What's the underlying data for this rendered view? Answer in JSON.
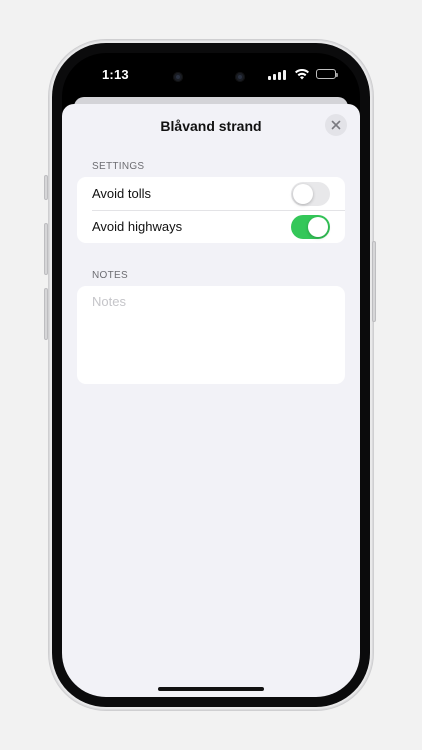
{
  "status_bar": {
    "time": "1:13",
    "icons": [
      "signal-icon",
      "wifi-icon",
      "battery-icon"
    ]
  },
  "sheet": {
    "title": "Blåvand strand",
    "close_icon": "close-icon"
  },
  "settings": {
    "header": "SETTINGS",
    "rows": [
      {
        "label": "Avoid tolls",
        "enabled": false
      },
      {
        "label": "Avoid highways",
        "enabled": true
      }
    ]
  },
  "notes": {
    "header": "NOTES",
    "value": "",
    "placeholder": "Notes"
  },
  "colors": {
    "toggle_on": "#34c759",
    "toggle_off": "#e8e8ea",
    "sheet_background": "#f2f2f7",
    "page_background": "#f2f2f2"
  }
}
